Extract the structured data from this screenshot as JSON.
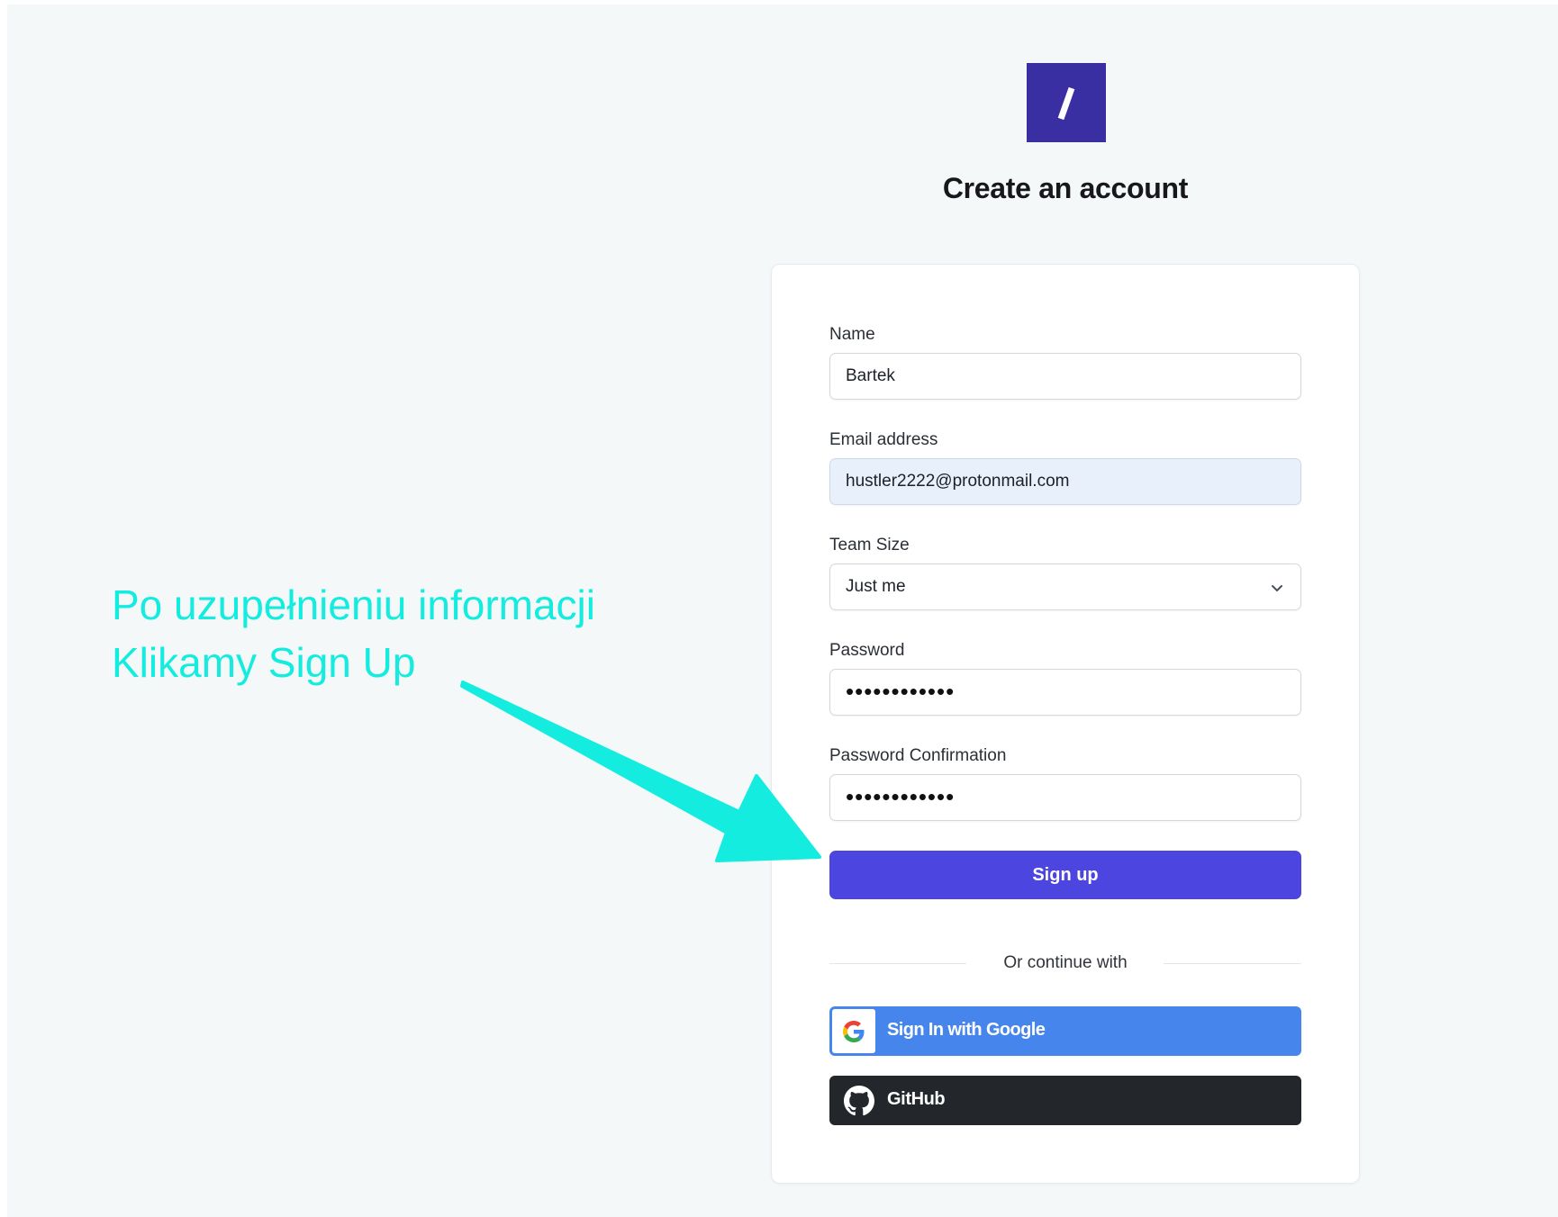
{
  "header": {
    "logo_glyph": "/",
    "title": "Create an account"
  },
  "form": {
    "name_label": "Name",
    "name_value": "Bartek",
    "email_label": "Email address",
    "email_value": "hustler2222@protonmail.com",
    "team_size_label": "Team Size",
    "team_size_value": "Just me",
    "password_label": "Password",
    "password_value": "••••••••••••",
    "password_confirmation_label": "Password Confirmation",
    "password_confirmation_value": "••••••••••••",
    "signup_label": "Sign up"
  },
  "social": {
    "divider_text": "Or continue with",
    "google_label": "Sign In with Google",
    "github_label": "GitHub"
  },
  "annotation": {
    "line1": "Po uzupełnieniu informacji",
    "line2": "Klikamy Sign Up",
    "color": "#15ece0"
  },
  "icons": {
    "chevron": "chevron-down-icon",
    "google": "google-g-icon",
    "github": "github-icon"
  },
  "colors": {
    "primary_button": "#4d45e0",
    "logo": "#3a2ea3",
    "google_button": "#4686ec",
    "github_button": "#23272b"
  }
}
